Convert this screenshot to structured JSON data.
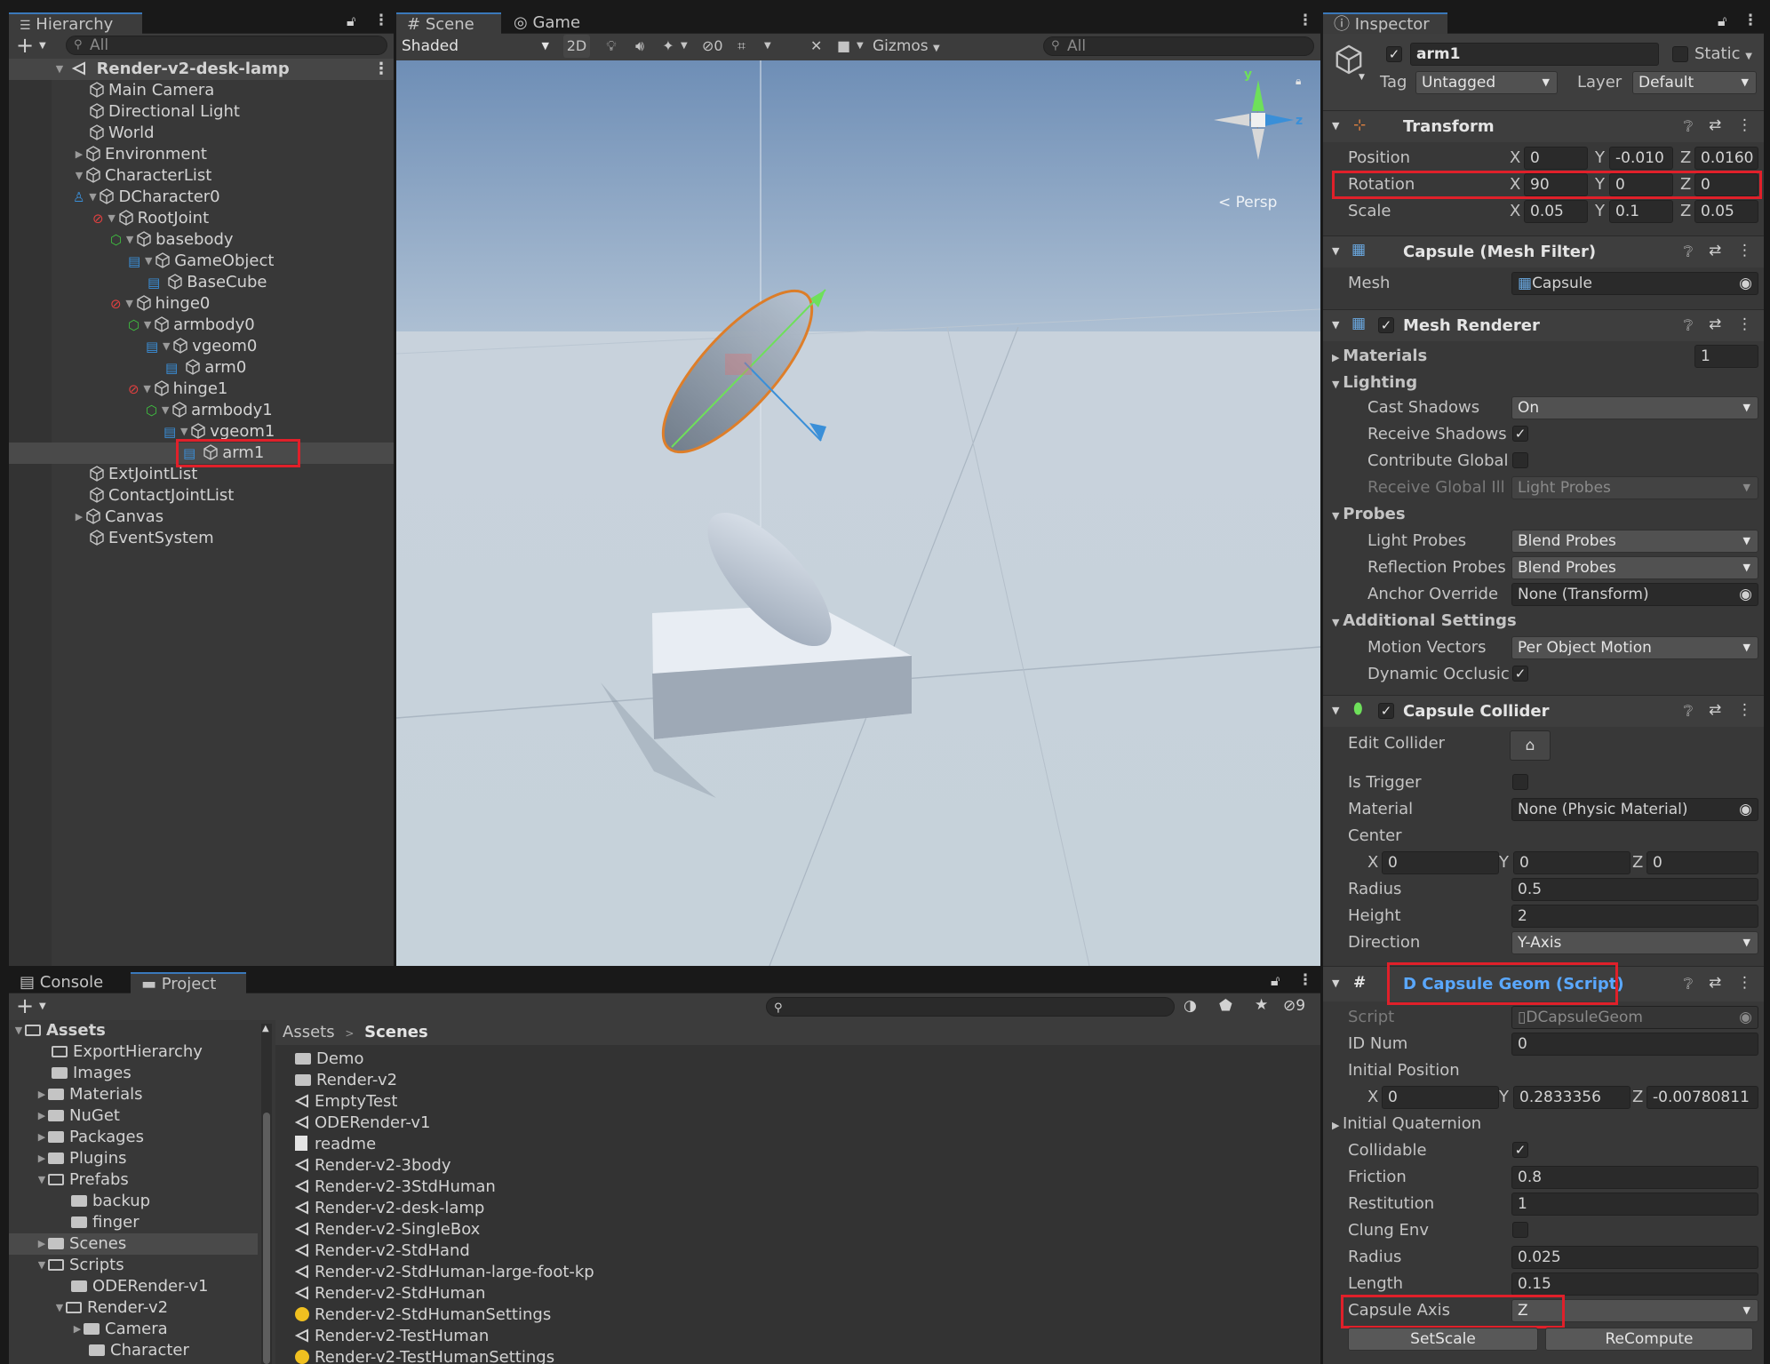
{
  "hierarchy": {
    "tab": "Hierarchy",
    "search_placeholder": "All",
    "scene_name": "Render-v2-desk-lamp",
    "items": [
      "Main Camera",
      "Directional Light",
      "World",
      "Environment",
      "CharacterList",
      "DCharacter0",
      "RootJoint",
      "basebody",
      "GameObject",
      "BaseCube",
      "hinge0",
      "armbody0",
      "vgeom0",
      "arm0",
      "hinge1",
      "armbody1",
      "vgeom1",
      "arm1",
      "ExtJointList",
      "ContactJointList",
      "Canvas",
      "EventSystem"
    ]
  },
  "scene": {
    "tabs": [
      "Scene",
      "Game"
    ],
    "shading": "Shaded",
    "mode2d": "2D",
    "hidden_count": "0",
    "gizmos": "Gizmos",
    "search_placeholder": "All",
    "persp_label": "Persp",
    "axis_y": "y",
    "axis_z": "z"
  },
  "inspector": {
    "tab": "Inspector",
    "object_name": "arm1",
    "static_label": "Static",
    "tag_label": "Tag",
    "tag_value": "Untagged",
    "layer_label": "Layer",
    "layer_value": "Default",
    "transform": {
      "title": "Transform",
      "position_label": "Position",
      "rotation_label": "Rotation",
      "scale_label": "Scale",
      "position": {
        "x": "0",
        "y": "-0.010",
        "z": "0.0160"
      },
      "rotation": {
        "x": "90",
        "y": "0",
        "z": "0"
      },
      "scale": {
        "x": "0.05",
        "y": "0.1",
        "z": "0.05"
      }
    },
    "mesh_filter": {
      "title": "Capsule (Mesh Filter)",
      "mesh_label": "Mesh",
      "mesh_value": "Capsule"
    },
    "mesh_renderer": {
      "title": "Mesh Renderer",
      "materials_label": "Materials",
      "materials_count": "1",
      "lighting_label": "Lighting",
      "cast_shadows_label": "Cast Shadows",
      "cast_shadows_value": "On",
      "receive_shadows_label": "Receive Shadows",
      "contribute_global_label": "Contribute Global",
      "receive_gi_label": "Receive Global Ill",
      "receive_gi_value": "Light Probes",
      "probes_label": "Probes",
      "light_probes_label": "Light Probes",
      "light_probes_value": "Blend Probes",
      "reflection_probes_label": "Reflection Probes",
      "reflection_probes_value": "Blend Probes",
      "anchor_override_label": "Anchor Override",
      "anchor_override_value": "None (Transform)",
      "additional_label": "Additional Settings",
      "motion_vectors_label": "Motion Vectors",
      "motion_vectors_value": "Per Object Motion",
      "dynamic_occlusion_label": "Dynamic Occlusic"
    },
    "capsule_collider": {
      "title": "Capsule Collider",
      "edit_collider_label": "Edit Collider",
      "is_trigger_label": "Is Trigger",
      "material_label": "Material",
      "material_value": "None (Physic Material)",
      "center_label": "Center",
      "center": {
        "x": "0",
        "y": "0",
        "z": "0"
      },
      "radius_label": "Radius",
      "radius_value": "0.5",
      "height_label": "Height",
      "height_value": "2",
      "direction_label": "Direction",
      "direction_value": "Y-Axis"
    },
    "capsule_geom": {
      "title": "D Capsule Geom (Script)",
      "script_label": "Script",
      "script_value": "DCapsuleGeom",
      "id_num_label": "ID Num",
      "id_num_value": "0",
      "initial_position_label": "Initial Position",
      "initial_position": {
        "x": "0",
        "y": "0.2833356",
        "z": "-0.00780811"
      },
      "initial_quaternion_label": "Initial Quaternion",
      "collidable_label": "Collidable",
      "friction_label": "Friction",
      "friction_value": "0.8",
      "restitution_label": "Restitution",
      "restitution_value": "1",
      "clung_env_label": "Clung Env",
      "radius_label": "Radius",
      "radius_value": "0.025",
      "length_label": "Length",
      "length_value": "0.15",
      "capsule_axis_label": "Capsule Axis",
      "capsule_axis_value": "Z",
      "setscale_label": "SetScale",
      "recompute_label": "ReCompute"
    }
  },
  "project": {
    "tabs": [
      "Console",
      "Project"
    ],
    "hidden_count": "9",
    "breadcrumb_root": "Assets",
    "breadcrumb_current": "Scenes",
    "tree": [
      "Assets",
      "ExportHierarchy",
      "Images",
      "Materials",
      "NuGet",
      "Packages",
      "Plugins",
      "Prefabs",
      "backup",
      "finger",
      "Scenes",
      "Scripts",
      "ODERender-v1",
      "Render-v2",
      "Camera",
      "Character"
    ],
    "files": [
      "Demo",
      "Render-v2",
      "EmptyTest",
      "ODERender-v1",
      "readme",
      "Render-v2-3body",
      "Render-v2-3StdHuman",
      "Render-v2-desk-lamp",
      "Render-v2-SingleBox",
      "Render-v2-StdHand",
      "Render-v2-StdHuman-large-foot-kp",
      "Render-v2-StdHuman",
      "Render-v2-StdHumanSettings",
      "Render-v2-TestHuman",
      "Render-v2-TestHumanSettings"
    ]
  },
  "colors": {
    "accent": "#3a79bb",
    "highlight": "#e0202a",
    "panel": "#383838"
  }
}
